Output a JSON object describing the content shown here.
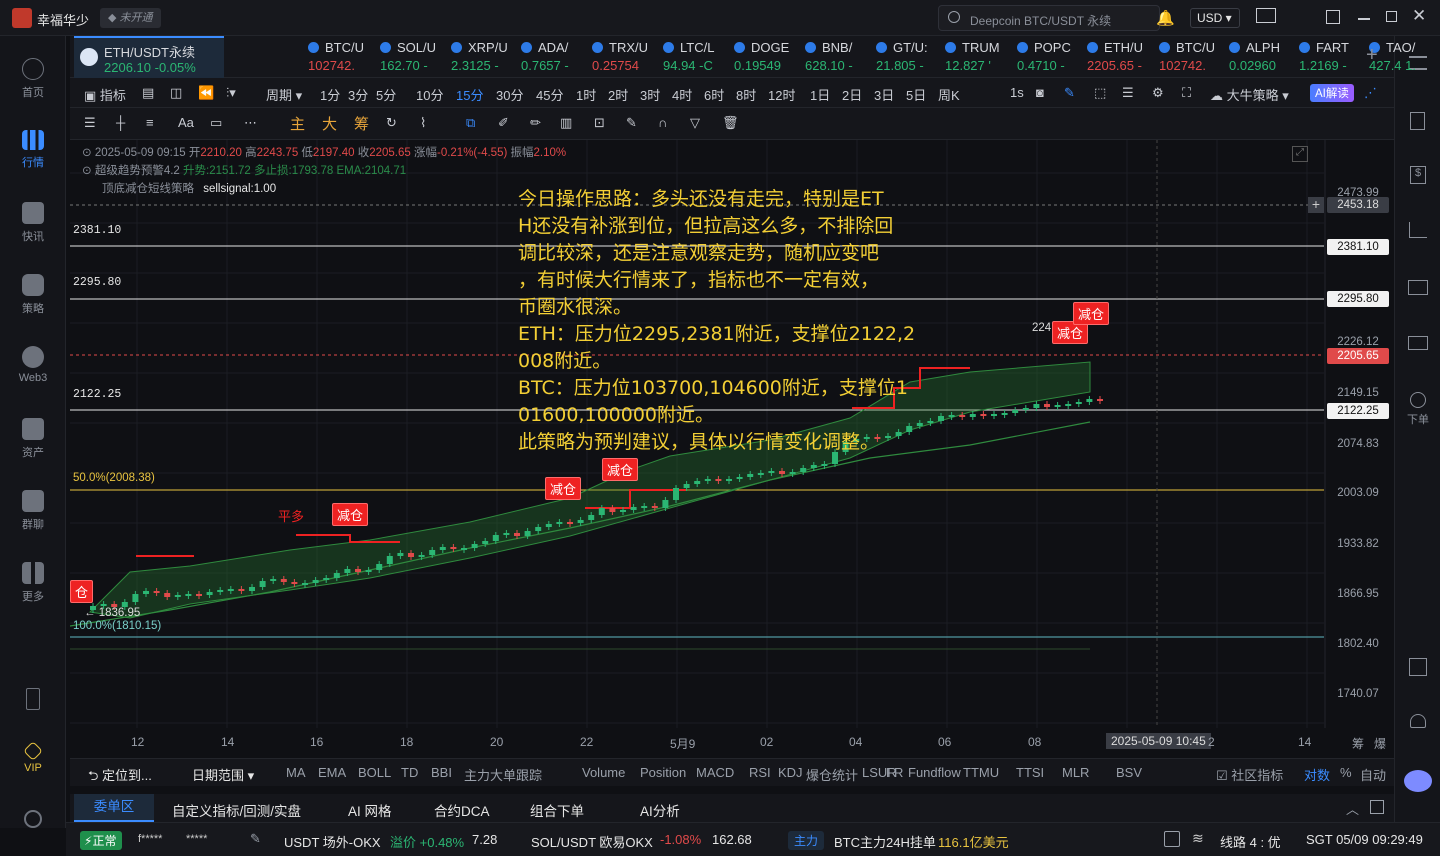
{
  "app": {
    "name": "幸福华少",
    "badge": "未开通",
    "search_placeholder": "Deepcoin BTC/USDT 永续",
    "currency": "USD"
  },
  "left_rail": [
    {
      "label": "首页",
      "icon": "home-icon"
    },
    {
      "label": "行情",
      "icon": "market-icon"
    },
    {
      "label": "快讯",
      "icon": "news-icon"
    },
    {
      "label": "策略",
      "icon": "strategy-icon"
    },
    {
      "label": "Web3",
      "icon": "web3-icon"
    },
    {
      "label": "资产",
      "icon": "wallet-icon"
    },
    {
      "label": "群聊",
      "icon": "chat-icon"
    },
    {
      "label": "更多",
      "icon": "more-icon"
    },
    {
      "label": "VIP",
      "icon": "vip-icon"
    }
  ],
  "right_rail": {
    "order_label": "下单"
  },
  "tickers": [
    {
      "name": "ETH/USDT永续",
      "price": "2206.10",
      "change": "-0.05%"
    },
    {
      "name": "BTC/U",
      "price": "102742.",
      "change": ""
    },
    {
      "name": "SOL/U",
      "price": "162.70",
      "change": "-"
    },
    {
      "name": "XRP/U",
      "price": "2.3125",
      "change": "-"
    },
    {
      "name": "ADA/",
      "price": "0.7657",
      "change": "-"
    },
    {
      "name": "TRX/U",
      "price": "0.25754",
      "change": ""
    },
    {
      "name": "LTC/L",
      "price": "94.94",
      "change": "-C"
    },
    {
      "name": "DOGE",
      "price": "0.19549",
      "change": ""
    },
    {
      "name": "BNB/",
      "price": "628.10",
      "change": "-"
    },
    {
      "name": "GT/U:",
      "price": "21.805",
      "change": "-"
    },
    {
      "name": "TRUM",
      "price": "12.827",
      "change": "'"
    },
    {
      "name": "POPC",
      "price": "0.4710",
      "change": "-"
    },
    {
      "name": "ETH/U",
      "price": "2205.65",
      "change": "-"
    },
    {
      "name": "BTC/U",
      "price": "102742.",
      "change": ""
    },
    {
      "name": "ALPH",
      "price": "0.02960",
      "change": ""
    },
    {
      "name": "FART",
      "price": "1.2169",
      "change": "-"
    },
    {
      "name": "TAO/",
      "price": "427.4",
      "change": "1."
    }
  ],
  "period_row": {
    "indicators": "指标",
    "cycle": "周期",
    "periods": [
      "1分",
      "3分",
      "5分",
      "10分",
      "15分",
      "30分",
      "45分",
      "1时",
      "2时",
      "3时",
      "4时",
      "6时",
      "8时",
      "12时",
      "1日",
      "2日",
      "3日",
      "5日",
      "周K"
    ],
    "active": "15分",
    "seconds": "1s",
    "strategy": "大牛策略",
    "ai": "AI解读"
  },
  "tool_row": {
    "font": "Aa",
    "main": "主",
    "big": "大",
    "chip": "筹"
  },
  "legend": {
    "line1": {
      "date": "2025-05-09 09:15",
      "open_l": "开",
      "open": "2210.20",
      "high_l": "高",
      "high": "2243.75",
      "low_l": "低",
      "low": "2197.40",
      "close_l": "收",
      "close": "2205.65",
      "chg_l": "涨幅",
      "chg": "-0.21%(-4.55)",
      "amp_l": "振幅",
      "amp": "2.10%"
    },
    "line2": {
      "name": "超级趋势预警4.2",
      "up": "升势:2151.72",
      "stop": "多止损:1793.78",
      "ema": "EMA:2104.71"
    },
    "line3": {
      "name": "顶底减仓短线策略",
      "sig": "sellsignal:1.00"
    }
  },
  "note": [
    "今日操作思路：多头还没有走完，特别是ET",
    "H还没有补涨到位，但拉高这么多，不排除回",
    "调比较深，还是注意观察走势，随机应变吧",
    "，有时候大行情来了，指标也不一定有效，",
    "币圈水很深。",
    "ETH：压力位2295,2381附近，支撑位2122,2",
    "008附近。",
    "BTC：压力位103700,104600附近，支撑位1",
    "01600,100000附近。",
    "此策略为预判建议，具体以行情变化调整。"
  ],
  "levels": {
    "l2381": "2381.10",
    "l2295": "2295.80",
    "l2122": "2122.25",
    "fib50": "50.0%(2008.38)",
    "fib100": "100.0%(1810.15)",
    "low": "1836.95",
    "hi_tag": "224"
  },
  "price_axis": [
    "2473.99",
    "2453.18",
    "2381.10",
    "2295.80",
    "2226.12",
    "2205.65",
    "2149.15",
    "2122.25",
    "2074.83",
    "2003.09",
    "1933.82",
    "1866.95",
    "1802.40",
    "1740.07"
  ],
  "time_axis": [
    "12",
    "14",
    "16",
    "18",
    "20",
    "22",
    "5月9",
    "02",
    "04",
    "06",
    "08",
    "2025-05-09 10:45",
    "2",
    "14"
  ],
  "signals": {
    "reduce": "减仓",
    "flat_long": "平多",
    "open": "仓"
  },
  "indicator_row": {
    "locate": "定位到...",
    "range": "日期范围",
    "items": [
      "MA",
      "EMA",
      "BOLL",
      "TD",
      "BBI",
      "主力大单跟踪",
      "Volume",
      "Position",
      "MACD",
      "RSI",
      "KDJ",
      "爆仓统计",
      "LSUR",
      "FR",
      "Fundflow",
      "TTMU",
      "TTSI",
      "MLR",
      "BSV"
    ],
    "community": "社区指标",
    "log": "对数",
    "pct": "%",
    "auto": "自动"
  },
  "tabs": [
    "委单区",
    "自定义指标/回测/实盘",
    "AI 网格",
    "合约DCA",
    "组合下单",
    "AI分析"
  ],
  "axis_corner": {
    "a": "筹",
    "b": "爆"
  },
  "status": {
    "state": "正常",
    "mask1": "f*****",
    "mask2": "*****",
    "usdt": "USDT 场外-OKX",
    "premium_l": "溢价",
    "premium": "+0.48%",
    "usdt_val": "7.28",
    "sol": "SOL/USDT 欧易OKX",
    "sol_chg": "-1.08%",
    "sol_price": "162.68",
    "main_tag": "主力",
    "btc_main": "BTC主力24H挂单",
    "btc_val": "116.1亿美元",
    "line": "线路 4 : 优",
    "time": "SGT 05/09 09:29:49"
  }
}
